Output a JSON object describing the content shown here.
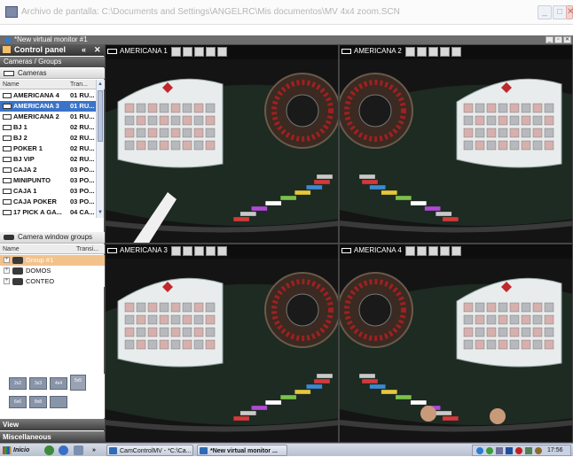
{
  "window": {
    "title": "Archivo de pantalla:  C:\\Documents and Settings\\ANGELRC\\Mis documentos\\MV 4x4 zoom.SCN",
    "min": "_",
    "max": "□",
    "close": "✕"
  },
  "inner": {
    "title": "*New virtual monitor #1",
    "btns": [
      "_",
      "▫",
      "✕"
    ]
  },
  "control_panel": {
    "title": "Control panel",
    "header_icons": [
      "«",
      "✕"
    ],
    "section_cameras_groups": "Cameras / Groups",
    "cameras_tab": "Cameras",
    "columns": {
      "name": "Name",
      "trans": "Tran..."
    },
    "cameras": [
      {
        "name": "AMERICANA 4",
        "trans": "01 RU..."
      },
      {
        "name": "AMERICANA 3",
        "trans": "01 RU..."
      },
      {
        "name": "AMERICANA 2",
        "trans": "01 RU..."
      },
      {
        "name": "BJ 1",
        "trans": "02 RU..."
      },
      {
        "name": "BJ 2",
        "trans": "02 RU..."
      },
      {
        "name": "POKER 1",
        "trans": "02 RU..."
      },
      {
        "name": "BJ VIP",
        "trans": "02 RU..."
      },
      {
        "name": "CAJA 2",
        "trans": "03 PO..."
      },
      {
        "name": "MINIPUNTO",
        "trans": "03 PO..."
      },
      {
        "name": "CAJA 1",
        "trans": "03 PO..."
      },
      {
        "name": "CAJA POKER",
        "trans": "03 PO..."
      },
      {
        "name": "17 PICK A GA...",
        "trans": "04 CA..."
      }
    ],
    "selected_camera_index": 1,
    "window_groups_tab": "Camera window groups",
    "group_columns": {
      "name": "Name",
      "trans": "Transi..."
    },
    "groups": [
      {
        "name": "Group #1",
        "selected": true
      },
      {
        "name": "DOMOS",
        "selected": false
      },
      {
        "name": "CONTEO",
        "selected": false
      }
    ],
    "layouts": [
      "2x2",
      "3x3",
      "4x4",
      "5x5",
      "6x6",
      "8x8"
    ],
    "view_label": "View",
    "misc_label": "Miscellaneous"
  },
  "video_panels": [
    {
      "label": "AMERICANA 1"
    },
    {
      "label": "AMERICANA 2"
    },
    {
      "label": "AMERICANA 3"
    },
    {
      "label": "AMERICANA 4"
    }
  ],
  "video_toolbar_icons": [
    "camera-snapshot",
    "record",
    "zoom",
    "audio",
    "settings"
  ],
  "taskbar": {
    "start": "Inicio",
    "quick_chevron": "»",
    "tasks": [
      {
        "label": "CamControlMV - *C:\\Ca..."
      },
      {
        "label": "*New virtual monitor ..."
      }
    ],
    "clock": "17:56"
  }
}
